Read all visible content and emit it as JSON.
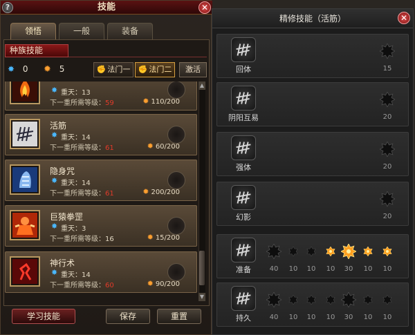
{
  "left_panel": {
    "title": "技能",
    "help_label": "?",
    "close_label": "✕",
    "tabs": [
      {
        "label": "领悟",
        "active": true
      },
      {
        "label": "一般",
        "active": false
      },
      {
        "label": "装备",
        "active": false
      }
    ],
    "race_skills_label": "种族技能",
    "points": {
      "blue": "0",
      "orange": "5"
    },
    "method_buttons": [
      {
        "label": "法门一",
        "active": false
      },
      {
        "label": "法门二",
        "active": true
      }
    ],
    "activate_label": "激活",
    "skills": [
      {
        "name": "",
        "level_text": "重天：13",
        "req_label": "下一重所需等级：",
        "req_value": "59",
        "req_met": false,
        "cost": "110/200"
      },
      {
        "name": "活筋",
        "level_text": "重天：14",
        "req_label": "下一重所需等级：",
        "req_value": "61",
        "req_met": false,
        "cost": "60/200"
      },
      {
        "name": "隐身咒",
        "level_text": "重天：14",
        "req_label": "下一重所需等级：",
        "req_value": "61",
        "req_met": false,
        "cost": "200/200"
      },
      {
        "name": "巨猿拳罡",
        "level_text": "重天：3",
        "req_label": "下一重所需等级：",
        "req_value": "16",
        "req_met": true,
        "cost": "15/200"
      },
      {
        "name": "神行术",
        "level_text": "重天：14",
        "req_label": "下一重所需等级：",
        "req_value": "60",
        "req_met": false,
        "cost": "90/200"
      }
    ],
    "buttons": {
      "learn": "学习技能",
      "save": "保存",
      "reset": "重置"
    }
  },
  "right_panel": {
    "title": "精修技能（活筋）",
    "close_label": "✕",
    "rows": [
      {
        "name": "回体",
        "nodes": [
          {
            "value": "15",
            "active": false,
            "big": true
          }
        ]
      },
      {
        "name": "阴阳互易",
        "nodes": [
          {
            "value": "20",
            "active": false,
            "big": true
          }
        ]
      },
      {
        "name": "强体",
        "nodes": [
          {
            "value": "20",
            "active": false,
            "big": true
          }
        ]
      },
      {
        "name": "幻影",
        "nodes": [
          {
            "value": "20",
            "active": false,
            "big": true
          }
        ]
      },
      {
        "name": "准备",
        "nodes": [
          {
            "value": "40",
            "active": false,
            "big": true
          },
          {
            "value": "10",
            "active": false,
            "big": false
          },
          {
            "value": "10",
            "active": false,
            "big": false
          },
          {
            "value": "10",
            "active": true,
            "big": false
          },
          {
            "value": "30",
            "active": true,
            "big": true
          },
          {
            "value": "10",
            "active": true,
            "big": false
          },
          {
            "value": "10",
            "active": true,
            "big": false
          }
        ]
      },
      {
        "name": "持久",
        "nodes": [
          {
            "value": "40",
            "active": false,
            "big": true
          },
          {
            "value": "10",
            "active": false,
            "big": false
          },
          {
            "value": "10",
            "active": false,
            "big": false
          },
          {
            "value": "10",
            "active": false,
            "big": false
          },
          {
            "value": "30",
            "active": false,
            "big": true
          },
          {
            "value": "10",
            "active": false,
            "big": false
          },
          {
            "value": "10",
            "active": false,
            "big": false
          }
        ]
      }
    ]
  },
  "colors": {
    "accent_red": "#8a1818",
    "req_unmet": "#e03a2a",
    "node_active": "#ffa020"
  }
}
